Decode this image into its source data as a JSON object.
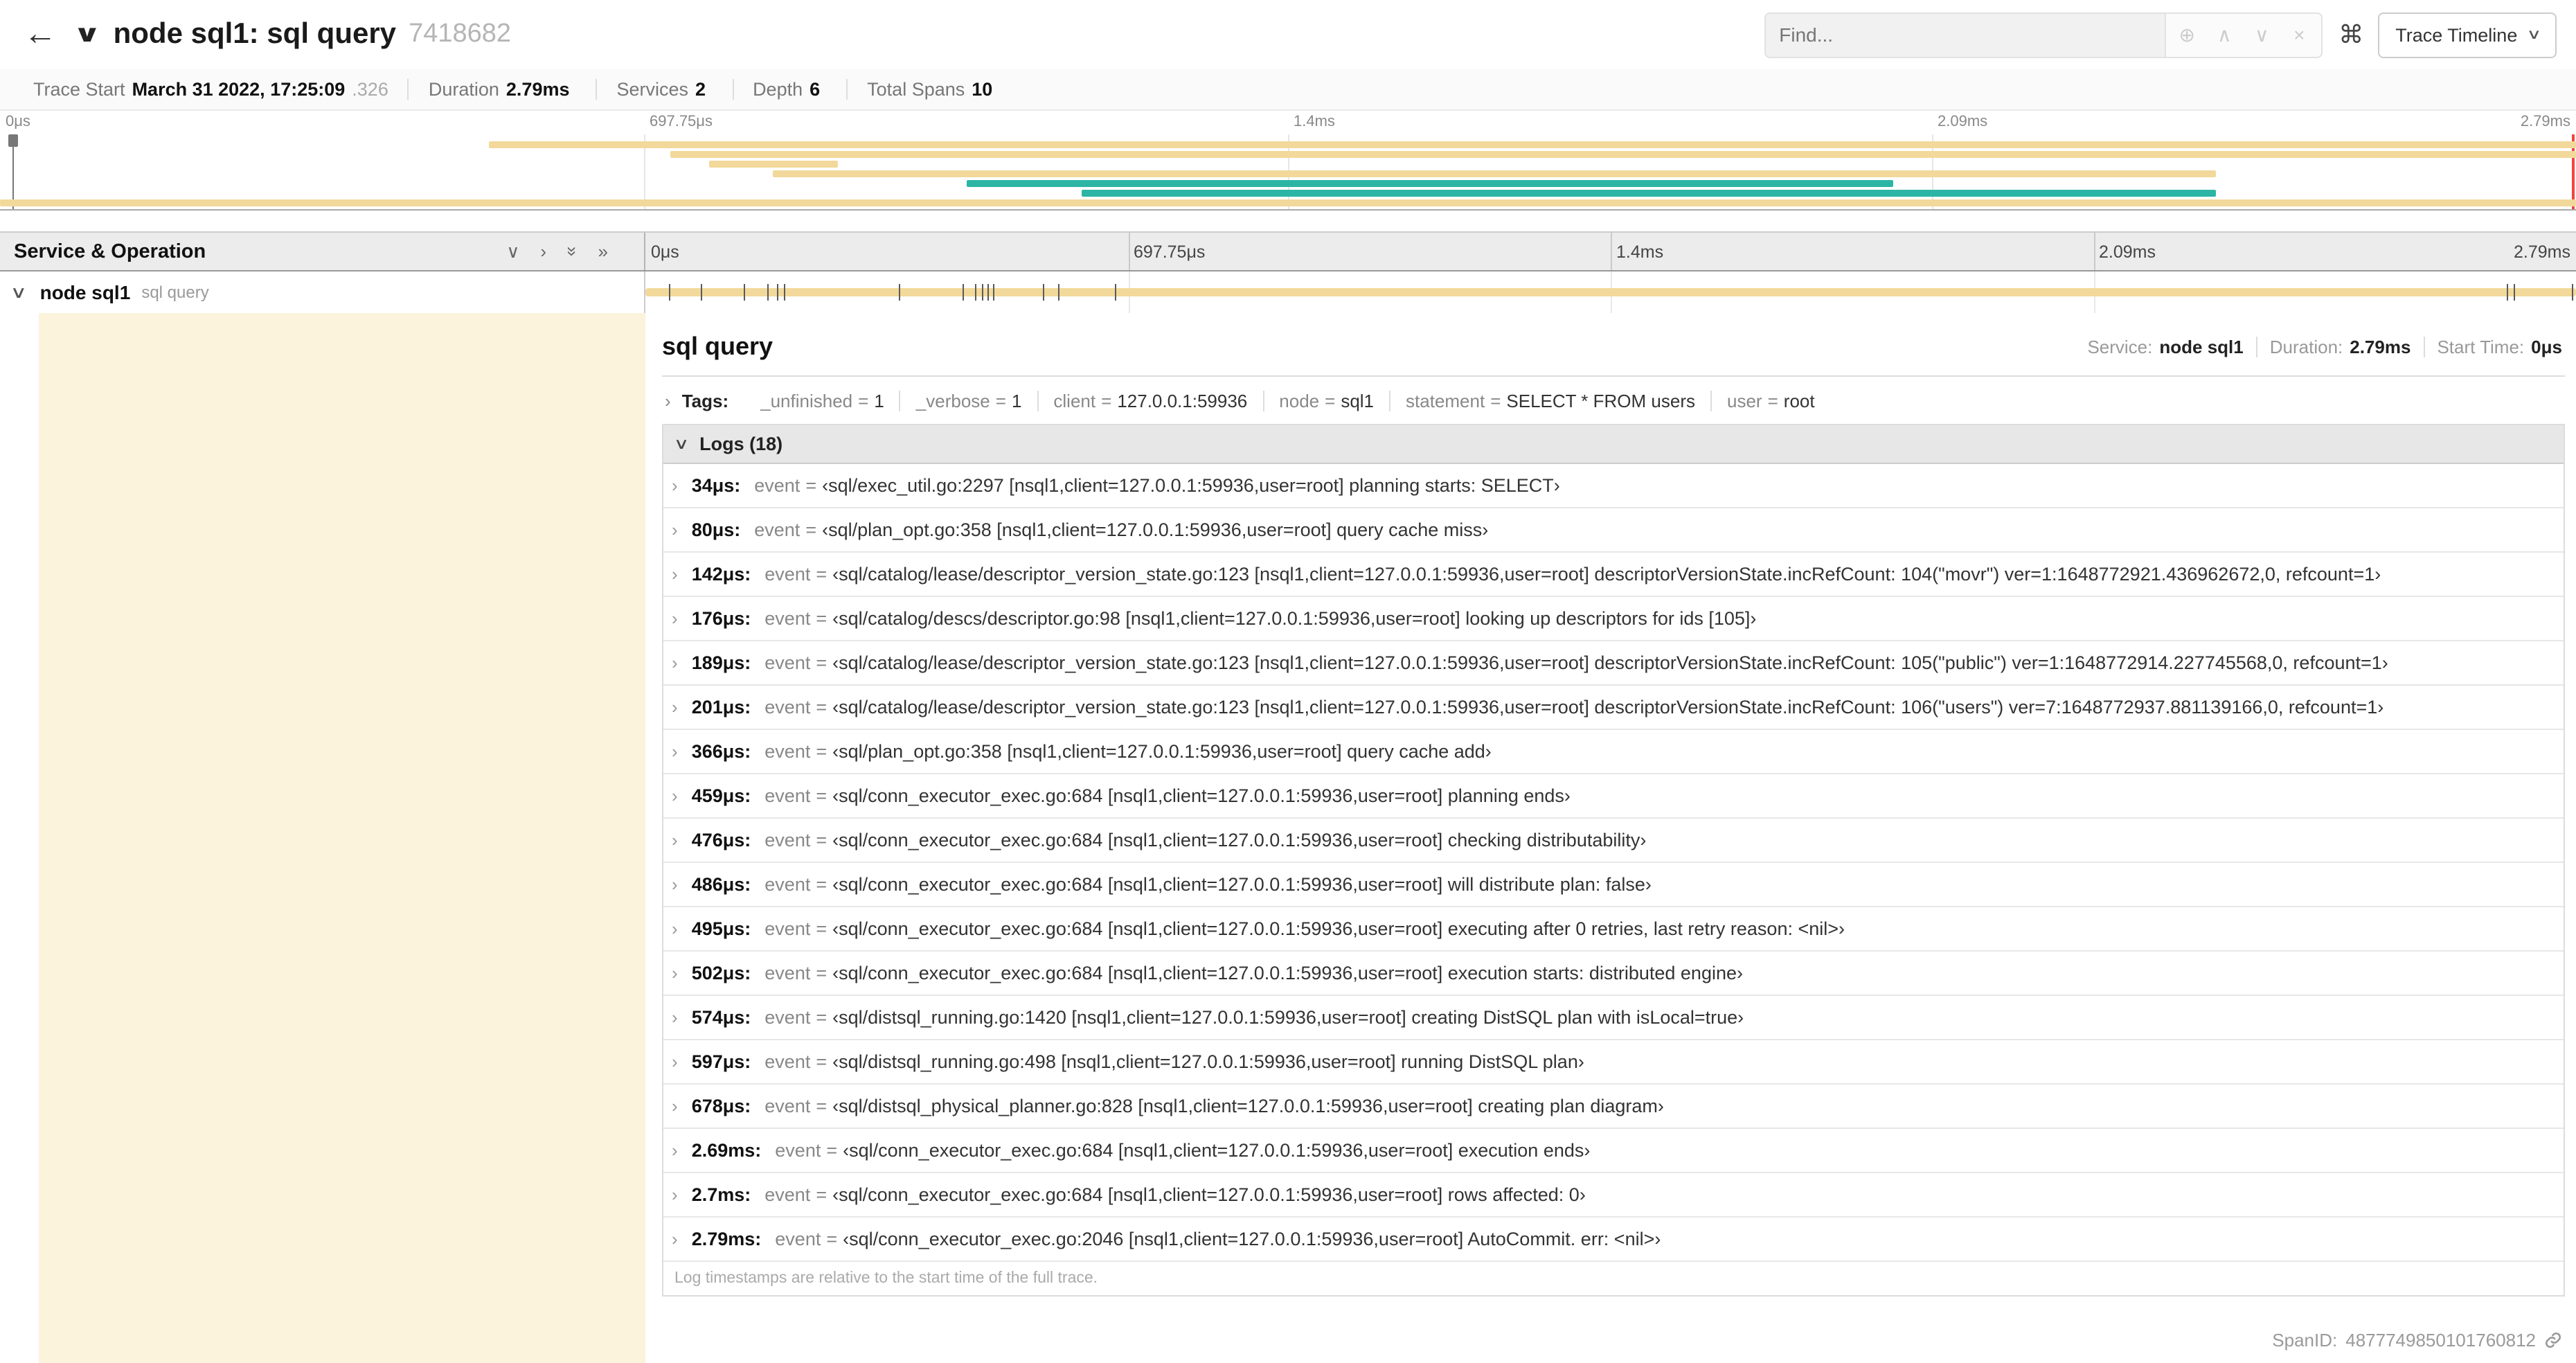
{
  "colors": {
    "span_tan": "#F2D99B",
    "span_teal": "#2CB5A4",
    "accent_bg": "#FBF3DC"
  },
  "header": {
    "back_icon": "←",
    "collapse_chevron": "∨",
    "title": "node sql1: sql query",
    "trace_id": "7418682",
    "find_placeholder": "Find...",
    "icons": {
      "focus": "⊕",
      "prev": "∧",
      "next": "∨",
      "clear": "×",
      "shortcuts": "⌘",
      "caret": "∨"
    },
    "view_selector": "Trace Timeline"
  },
  "summary": {
    "items": [
      {
        "label": "Trace Start",
        "value": "March 31 2022, 17:25:09",
        "suffix": ".326"
      },
      {
        "label": "Duration",
        "value": "2.79ms",
        "suffix": ""
      },
      {
        "label": "Services",
        "value": "2",
        "suffix": ""
      },
      {
        "label": "Depth",
        "value": "6",
        "suffix": ""
      },
      {
        "label": "Total Spans",
        "value": "10",
        "suffix": ""
      }
    ]
  },
  "timeline": {
    "ticks": [
      "0μs",
      "697.75μs",
      "1.4ms",
      "2.09ms",
      "2.79ms"
    ],
    "minimap_spans": [
      {
        "left": "19%",
        "width": "81%",
        "background": "#F2D99B"
      },
      {
        "left": "26%",
        "width": "74%",
        "background": "#F2D99B"
      },
      {
        "left": "27.5%",
        "width": "5%",
        "background": "#F2D99B"
      },
      {
        "left": "30%",
        "width": "56%",
        "background": "#F2D99B"
      },
      {
        "left": "37.5%",
        "width": "36%",
        "background": "#2CB5A4"
      },
      {
        "left": "42%",
        "width": "44%",
        "background": "#2CB5A4"
      },
      {
        "left": "0%",
        "width": "100%",
        "background": "#F2D99B"
      }
    ]
  },
  "grid": {
    "left_header": "Service & Operation",
    "icons": {
      "collapse_one": "∨",
      "expand_one": "›",
      "collapse_all": "»",
      "expand_all": "»"
    }
  },
  "span_row": {
    "service": "node sql1",
    "operation": "sql query",
    "log_markers": [
      {
        "left": "1.2%"
      },
      {
        "left": "2.9%"
      },
      {
        "left": "5.1%"
      },
      {
        "left": "6.3%"
      },
      {
        "left": "6.8%"
      },
      {
        "left": "7.2%"
      },
      {
        "left": "13.1%"
      },
      {
        "left": "16.4%"
      },
      {
        "left": "17.1%"
      },
      {
        "left": "17.4%"
      },
      {
        "left": "17.7%"
      },
      {
        "left": "18%"
      },
      {
        "left": "20.6%"
      },
      {
        "left": "21.4%"
      },
      {
        "left": "24.3%"
      },
      {
        "left": "96.4%"
      },
      {
        "left": "96.8%"
      },
      {
        "left": "99.8%"
      }
    ]
  },
  "detail": {
    "title": "sql query",
    "meta": [
      {
        "label": "Service:",
        "value": "node sql1"
      },
      {
        "label": "Duration:",
        "value": "2.79ms"
      },
      {
        "label": "Start Time:",
        "value": "0μs"
      }
    ],
    "tags_label": "Tags:",
    "kv_separator": "=",
    "row_chevron": "›",
    "tags": [
      {
        "key": "_unfinished",
        "value": "1"
      },
      {
        "key": "_verbose",
        "value": "1"
      },
      {
        "key": "client",
        "value": "127.0.0.1:59936"
      },
      {
        "key": "node",
        "value": "sql1"
      },
      {
        "key": "statement",
        "value": "SELECT * FROM users"
      },
      {
        "key": "user",
        "value": "root"
      }
    ],
    "logs_title": "Logs (18)",
    "logs_chevron": "∨",
    "log_field_key": "event",
    "logs": [
      {
        "time": "34μs:",
        "value": "‹sql/exec_util.go:2297 [nsql1,client=127.0.0.1:59936,user=root] planning starts: SELECT›"
      },
      {
        "time": "80μs:",
        "value": "‹sql/plan_opt.go:358 [nsql1,client=127.0.0.1:59936,user=root] query cache miss›"
      },
      {
        "time": "142μs:",
        "value": "‹sql/catalog/lease/descriptor_version_state.go:123 [nsql1,client=127.0.0.1:59936,user=root] descriptorVersionState.incRefCount: 104(\"movr\") ver=1:1648772921.436962672,0, refcount=1›"
      },
      {
        "time": "176μs:",
        "value": "‹sql/catalog/descs/descriptor.go:98 [nsql1,client=127.0.0.1:59936,user=root] looking up descriptors for ids [105]›"
      },
      {
        "time": "189μs:",
        "value": "‹sql/catalog/lease/descriptor_version_state.go:123 [nsql1,client=127.0.0.1:59936,user=root] descriptorVersionState.incRefCount: 105(\"public\") ver=1:1648772914.227745568,0, refcount=1›"
      },
      {
        "time": "201μs:",
        "value": "‹sql/catalog/lease/descriptor_version_state.go:123 [nsql1,client=127.0.0.1:59936,user=root] descriptorVersionState.incRefCount: 106(\"users\") ver=7:1648772937.881139166,0, refcount=1›"
      },
      {
        "time": "366μs:",
        "value": "‹sql/plan_opt.go:358 [nsql1,client=127.0.0.1:59936,user=root] query cache add›"
      },
      {
        "time": "459μs:",
        "value": "‹sql/conn_executor_exec.go:684 [nsql1,client=127.0.0.1:59936,user=root] planning ends›"
      },
      {
        "time": "476μs:",
        "value": "‹sql/conn_executor_exec.go:684 [nsql1,client=127.0.0.1:59936,user=root] checking distributability›"
      },
      {
        "time": "486μs:",
        "value": "‹sql/conn_executor_exec.go:684 [nsql1,client=127.0.0.1:59936,user=root] will distribute plan: false›"
      },
      {
        "time": "495μs:",
        "value": "‹sql/conn_executor_exec.go:684 [nsql1,client=127.0.0.1:59936,user=root] executing after 0 retries, last retry reason: <nil>›"
      },
      {
        "time": "502μs:",
        "value": "‹sql/conn_executor_exec.go:684 [nsql1,client=127.0.0.1:59936,user=root] execution starts: distributed engine›"
      },
      {
        "time": "574μs:",
        "value": "‹sql/distsql_running.go:1420 [nsql1,client=127.0.0.1:59936,user=root] creating DistSQL plan with isLocal=true›"
      },
      {
        "time": "597μs:",
        "value": "‹sql/distsql_running.go:498 [nsql1,client=127.0.0.1:59936,user=root] running DistSQL plan›"
      },
      {
        "time": "678μs:",
        "value": "‹sql/distsql_physical_planner.go:828 [nsql1,client=127.0.0.1:59936,user=root] creating plan diagram›"
      },
      {
        "time": "2.69ms:",
        "value": "‹sql/conn_executor_exec.go:684 [nsql1,client=127.0.0.1:59936,user=root] execution ends›"
      },
      {
        "time": "2.7ms:",
        "value": "‹sql/conn_executor_exec.go:684 [nsql1,client=127.0.0.1:59936,user=root] rows affected: 0›"
      },
      {
        "time": "2.79ms:",
        "value": "‹sql/conn_executor_exec.go:2046 [nsql1,client=127.0.0.1:59936,user=root] AutoCommit. err: <nil>›"
      }
    ],
    "logs_footer": "Log timestamps are relative to the start time of the full trace.",
    "span_id_label": "SpanID:",
    "span_id_value": "4877749850101760812"
  }
}
